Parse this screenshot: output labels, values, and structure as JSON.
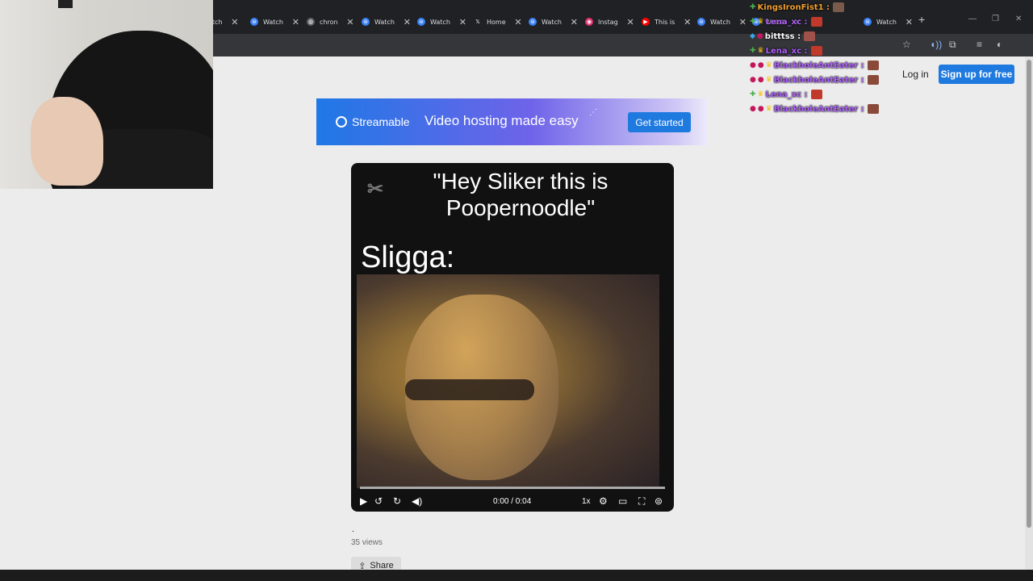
{
  "browser": {
    "tabs": [
      {
        "label": "atch",
        "icon": "streamable-icon"
      },
      {
        "label": "Watch",
        "icon": "streamable-icon"
      },
      {
        "label": "chron",
        "icon": "globe-icon"
      },
      {
        "label": "Watch",
        "icon": "streamable-icon"
      },
      {
        "label": "Watch",
        "icon": "streamable-icon"
      },
      {
        "label": "Home",
        "icon": "x-icon"
      },
      {
        "label": "Watch",
        "icon": "streamable-icon"
      },
      {
        "label": "Instag",
        "icon": "instagram-icon"
      },
      {
        "label": "This is",
        "icon": "youtube-icon"
      },
      {
        "label": "Watch",
        "icon": "streamable-icon"
      },
      {
        "label": "Watch",
        "icon": "streamable-icon"
      },
      {
        "label": "Watch",
        "icon": "streamable-icon"
      }
    ]
  },
  "header": {
    "login": "Log in",
    "signup": "Sign up for free"
  },
  "banner": {
    "brand": "Streamable",
    "tagline": "Video hosting made easy",
    "cta": "Get started"
  },
  "video": {
    "caption_line1": "\"Hey Sliker this is",
    "caption_line2": "Poopernoodle\"",
    "sligga": "Sligga:",
    "time": "0:00 / 0:04",
    "speed": "1x",
    "progress": 0.0
  },
  "meta": {
    "title": ".",
    "views": "35 views",
    "share": "Share"
  },
  "chat": [
    {
      "user": "KingsIronFist1 :",
      "color": "#f0a030"
    },
    {
      "user": "Lena_xc :",
      "color": "#b060ff"
    },
    {
      "user": "bitttss :",
      "color": "#ffffff"
    },
    {
      "user": "Lena_xc :",
      "color": "#b060ff"
    },
    {
      "user": "BlackholeAntEater :",
      "color": "#b060ff"
    },
    {
      "user": "BlackholeAntEater :",
      "color": "#b060ff"
    },
    {
      "user": "Lena_xc :",
      "color": "#b060ff"
    },
    {
      "user": "BlackholeAntEater :",
      "color": "#b060ff"
    }
  ],
  "colors": {
    "accent": "#1f7ae0",
    "page_bg": "#ececec",
    "chrome_bg": "#202124"
  }
}
